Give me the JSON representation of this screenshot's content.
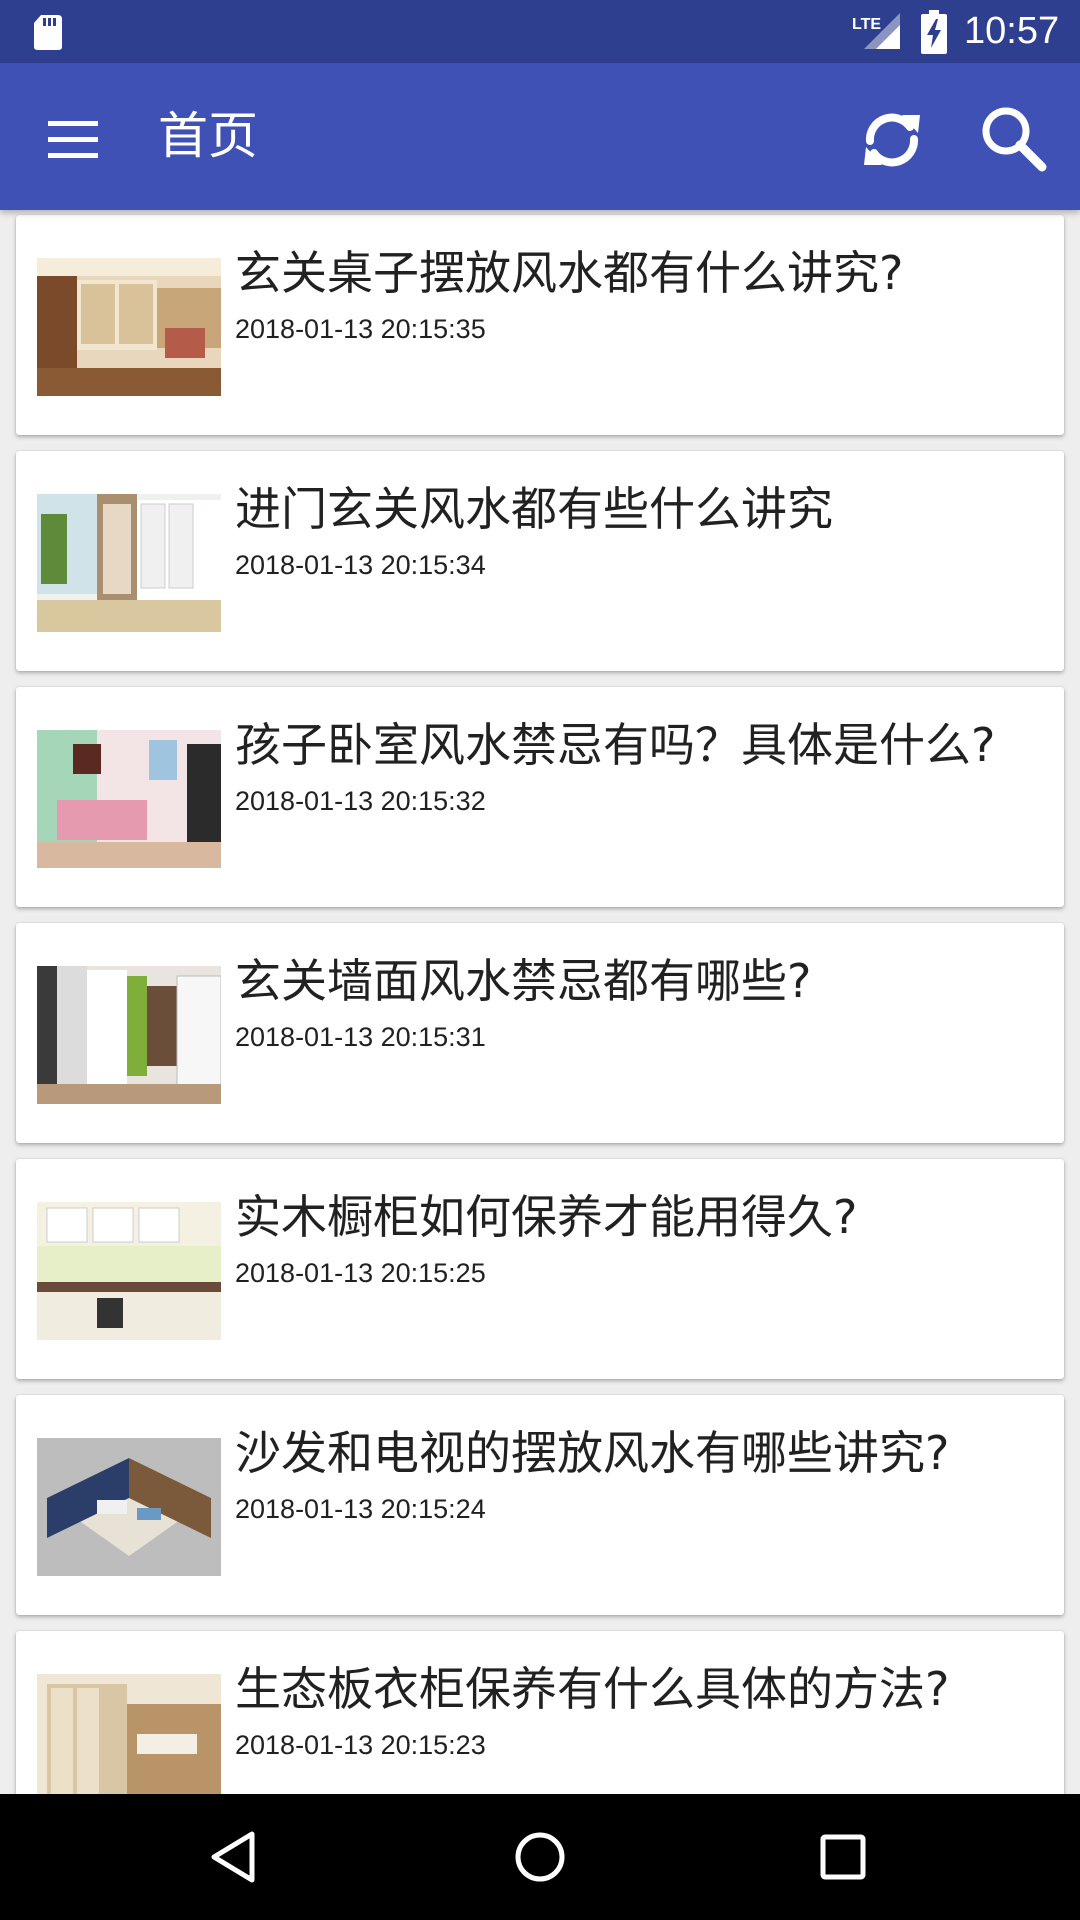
{
  "status_bar": {
    "time": "10:57",
    "network_label": "LTE",
    "icons": [
      "sd-card-icon",
      "lte-signal-icon",
      "battery-charging-icon"
    ]
  },
  "toolbar": {
    "title": "首页",
    "icons": [
      "menu-icon",
      "refresh-icon",
      "search-icon"
    ],
    "color": "#3f51b5"
  },
  "articles": [
    {
      "title": "玄关桌子摆放风水都有什么讲究?",
      "time": "2018-01-13 20:15:35"
    },
    {
      "title": "进门玄关风水都有些什么讲究",
      "time": "2018-01-13 20:15:34"
    },
    {
      "title": "孩子卧室风水禁忌有吗？具体是什么?",
      "time": "2018-01-13 20:15:32"
    },
    {
      "title": "玄关墙面风水禁忌都有哪些?",
      "time": "2018-01-13 20:15:31"
    },
    {
      "title": "实木橱柜如何保养才能用得久?",
      "time": "2018-01-13 20:15:25"
    },
    {
      "title": "沙发和电视的摆放风水有哪些讲究?",
      "time": "2018-01-13 20:15:24"
    },
    {
      "title": "生态板衣柜保养有什么具体的方法?",
      "time": "2018-01-13 20:15:23"
    }
  ],
  "nav_bar": {
    "icons": [
      "back-icon",
      "home-icon",
      "recents-icon"
    ]
  },
  "colors": {
    "status_bar": "#2f3f8f",
    "toolbar": "#3f51b5",
    "background": "#eeeeee",
    "card": "#ffffff",
    "text": "#212121"
  }
}
